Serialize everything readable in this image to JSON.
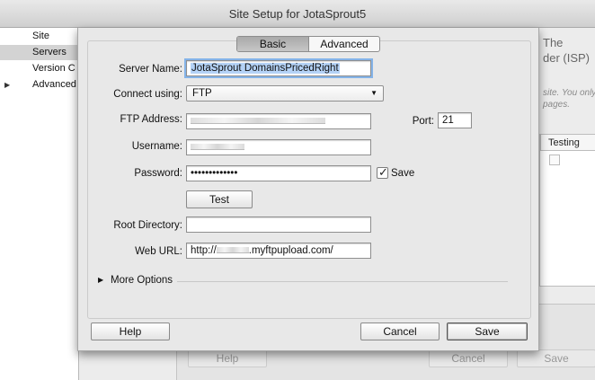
{
  "window": {
    "title": "Site Setup for JotaSprout5"
  },
  "sidebar": {
    "items": [
      {
        "label": "Site"
      },
      {
        "label": "Servers"
      },
      {
        "label": "Version C"
      },
      {
        "label": "Advanced"
      }
    ]
  },
  "background": {
    "heading": "The\nder (ISP)",
    "note": "site. You only\npages.",
    "table_header": "Testing",
    "help_label": "Help",
    "cancel_label": "Cancel",
    "save_label": "Save"
  },
  "tabs": [
    {
      "label": "Basic"
    },
    {
      "label": "Advanced"
    }
  ],
  "form": {
    "server_name_label": "Server Name:",
    "server_name_value": "JotaSprout DomainsPricedRight",
    "connect_label": "Connect using:",
    "connect_value": "FTP",
    "ftp_address_label": "FTP Address:",
    "port_label": "Port:",
    "port_value": "21",
    "username_label": "Username:",
    "password_label": "Password:",
    "password_value": "•••••••••••••",
    "save_checkbox_label": "Save",
    "test_label": "Test",
    "root_dir_label": "Root Directory:",
    "root_dir_value": "",
    "web_url_label": "Web URL:",
    "web_url_prefix": "http://",
    "web_url_suffix": ".myftpupload.com/",
    "more_options_label": "More Options"
  },
  "footer": {
    "help_label": "Help",
    "cancel_label": "Cancel",
    "save_label": "Save"
  }
}
